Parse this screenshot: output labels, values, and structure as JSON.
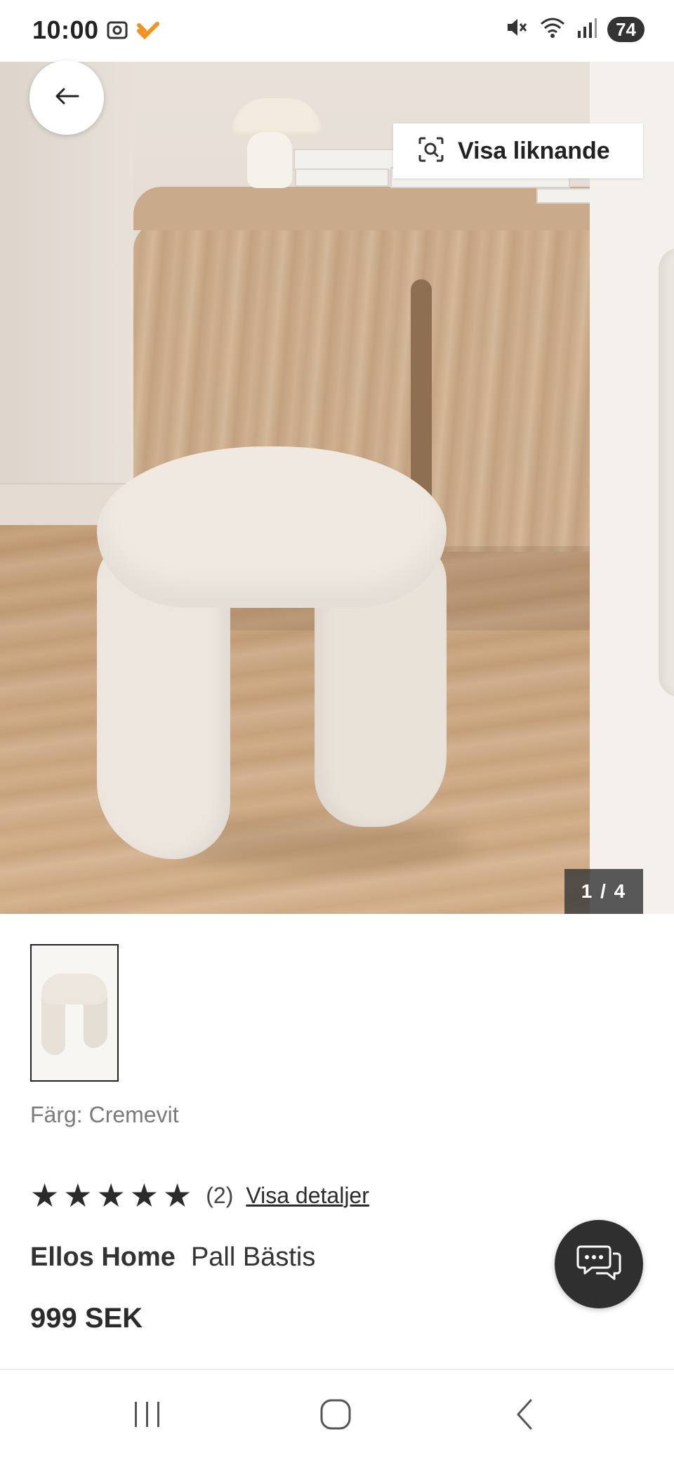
{
  "status_bar": {
    "time": "10:00",
    "battery": "74",
    "icons": [
      "screenshot-icon",
      "app-badge-icon",
      "mute-icon",
      "wifi-icon",
      "signal-icon",
      "battery-icon"
    ]
  },
  "gallery": {
    "similar_label": "Visa liknande",
    "counter": "1 / 4",
    "current_index": 1,
    "total_images": 4
  },
  "product": {
    "color_label": "Färg: Cremevit",
    "rating": 5,
    "review_count": "(2)",
    "details_link": "Visa detaljer",
    "brand": "Ellos Home",
    "name": "Pall Bästis",
    "price": "999 SEK"
  },
  "navigation": {
    "buttons": [
      "recents-button",
      "home-button",
      "back-button"
    ]
  },
  "colors": {
    "text_primary": "#2b2b2b",
    "text_secondary": "#7a7a7a",
    "chat_button": "#2f2f2f",
    "counter_bg": "#3c3c3c"
  }
}
